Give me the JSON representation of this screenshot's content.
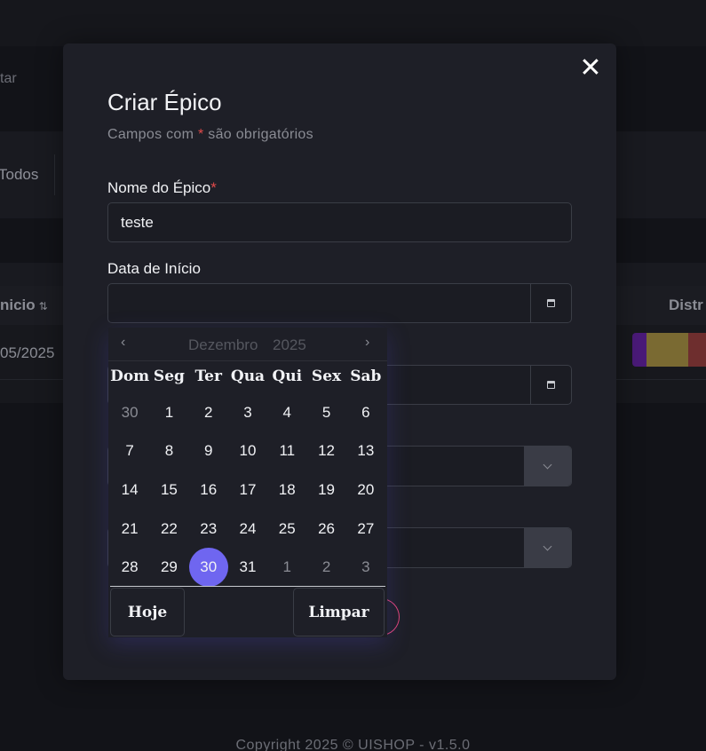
{
  "background": {
    "filter_text": "tar",
    "tab_label": "Todos",
    "table_head_left": "nicio",
    "sort_icon": "sort-icon",
    "table_head_right": "Distr",
    "row_date": "05/2025",
    "footer": "Copyright 2025 © UISHOP - v1.5.0"
  },
  "modal": {
    "title": "Criar Épico",
    "subtitle_prefix": "Campos com ",
    "subtitle_star": "*",
    "subtitle_suffix": " são obrigatórios",
    "close_icon": "close-icon",
    "fields": {
      "name_label": "Nome do Épico",
      "name_required": "*",
      "name_value": "teste",
      "start_label": "Data de Início"
    }
  },
  "calendar": {
    "month": "Dezembro",
    "year": "2025",
    "prev": "‹",
    "next": "›",
    "weekdays": [
      "Dom",
      "Seg",
      "Ter",
      "Qua",
      "Qui",
      "Sex",
      "Sab"
    ],
    "weeks": [
      [
        "30",
        "1",
        "2",
        "3",
        "4",
        "5",
        "6"
      ],
      [
        "7",
        "8",
        "9",
        "10",
        "11",
        "12",
        "13"
      ],
      [
        "14",
        "15",
        "16",
        "17",
        "18",
        "19",
        "20"
      ],
      [
        "21",
        "22",
        "23",
        "24",
        "25",
        "26",
        "27"
      ],
      [
        "28",
        "29",
        "30",
        "31",
        "1",
        "2",
        "3"
      ]
    ],
    "selected": "30",
    "today_label": "Hoje",
    "clear_label": "Limpar"
  },
  "colors": {
    "accent": "#6f66f0",
    "required": "#e04a4a"
  }
}
